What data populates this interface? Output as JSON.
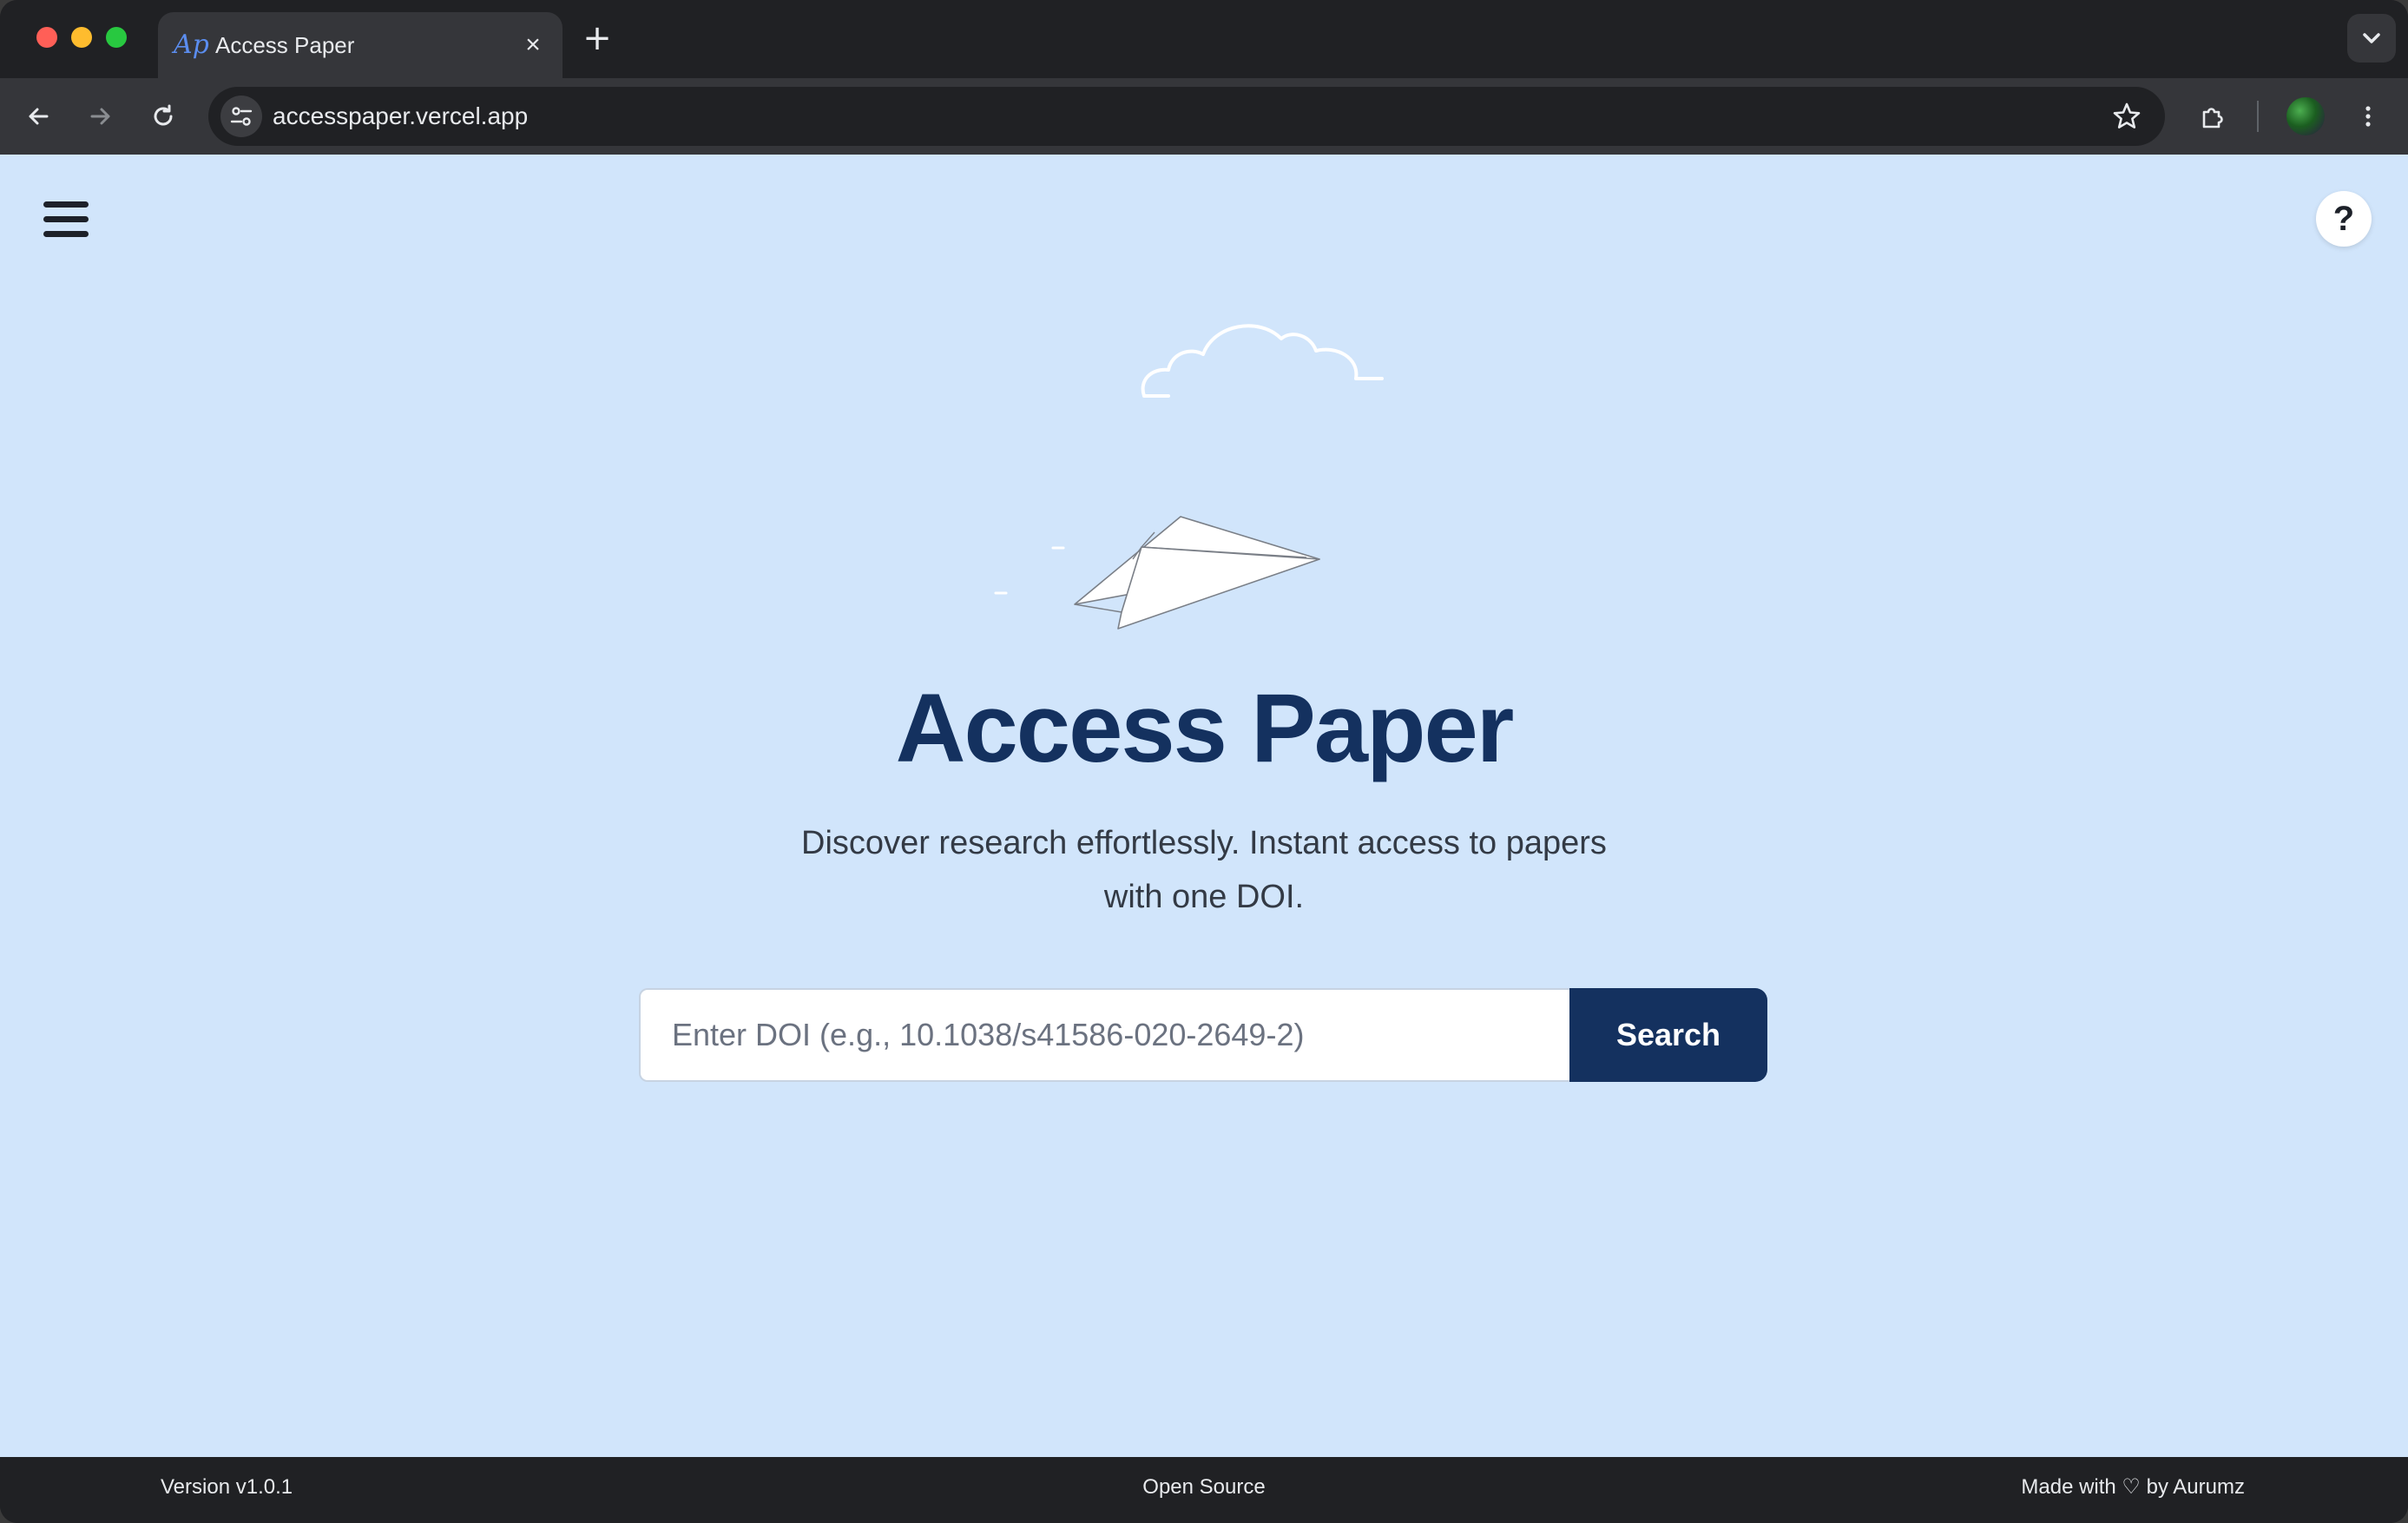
{
  "browser": {
    "tab": {
      "favicon": "Ap",
      "title": "Access Paper",
      "close": "×"
    },
    "new_tab": "+",
    "url": "accesspaper.vercel.app"
  },
  "page": {
    "help": "?",
    "title": "Access Paper",
    "subtitle": "Discover research effortlessly. Instant access to papers with one DOI.",
    "search": {
      "placeholder": "Enter DOI (e.g., 10.1038/s41586-020-2649-2)",
      "value": "",
      "button_label": "Search"
    }
  },
  "footer": {
    "version": "Version v1.0.1",
    "open_source": "Open Source",
    "made_with": "Made with ♡ by Aurumz"
  },
  "colors": {
    "page_bg": "#d1e5fb",
    "brand_navy": "#14315f",
    "chrome_dark": "#202124",
    "chrome_toolbar": "#35363a"
  },
  "icons": {
    "back": "arrow-left-icon",
    "forward": "arrow-right-icon",
    "reload": "reload-icon",
    "site_info": "tune-icon",
    "bookmark": "star-icon",
    "extensions": "puzzle-icon",
    "menu": "kebab-icon",
    "hamburger": "hamburger-menu-icon",
    "help": "question-icon",
    "decor_cloud": "cloud-icon",
    "decor_plane": "paper-plane-icon"
  }
}
